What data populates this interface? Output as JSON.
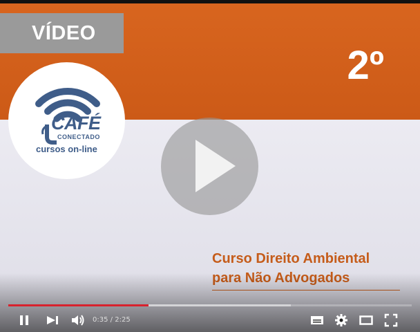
{
  "slide": {
    "video_tag": "VÍDEO",
    "lesson_number": "2º",
    "logo": {
      "brand": "CAFÉ",
      "sub": "CONECTADO",
      "tagline": "cursos on-line"
    },
    "course_title_line1": "Curso Direito Ambiental",
    "course_title_line2": "para Não Advogados"
  },
  "player": {
    "current_time": "0:35",
    "separator": "/",
    "duration": "2:25",
    "progress_played_percent": 34.75,
    "progress_buffered_percent": 70
  },
  "colors": {
    "orange": "#d8651f",
    "title_orange": "#c55c1a",
    "logo_blue": "#3f5d89",
    "progress_red": "#d8222d"
  },
  "icons": {
    "pause": "pause-icon",
    "next": "next-icon",
    "volume": "volume-icon",
    "subtitles": "subtitles-icon",
    "settings": "gear-icon",
    "theater": "theater-icon",
    "fullscreen": "fullscreen-icon",
    "play_overlay": "play-icon"
  }
}
